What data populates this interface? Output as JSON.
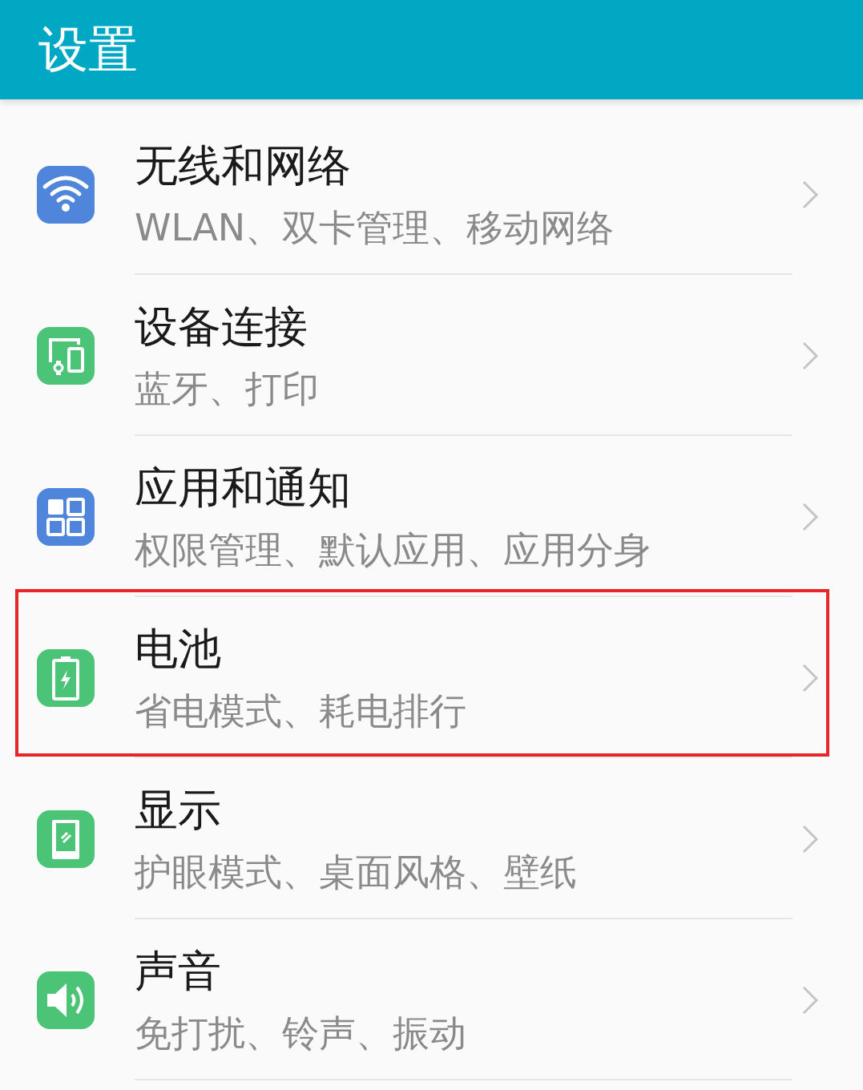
{
  "header": {
    "title": "设置"
  },
  "items": [
    {
      "kind": "wifi",
      "color": "#4f86dc",
      "title": "无线和网络",
      "subtitle": "WLAN、双卡管理、移动网络",
      "highlighted": false
    },
    {
      "kind": "devices",
      "color": "#4cc478",
      "title": "设备连接",
      "subtitle": "蓝牙、打印",
      "highlighted": false
    },
    {
      "kind": "apps",
      "color": "#4f86dc",
      "title": "应用和通知",
      "subtitle": "权限管理、默认应用、应用分身",
      "highlighted": false
    },
    {
      "kind": "battery",
      "color": "#4cc478",
      "title": "电池",
      "subtitle": "省电模式、耗电排行",
      "highlighted": true
    },
    {
      "kind": "display",
      "color": "#4cc478",
      "title": "显示",
      "subtitle": "护眼模式、桌面风格、壁纸",
      "highlighted": false
    },
    {
      "kind": "sound",
      "color": "#4cc478",
      "title": "声音",
      "subtitle": "免打扰、铃声、振动",
      "highlighted": false
    }
  ]
}
